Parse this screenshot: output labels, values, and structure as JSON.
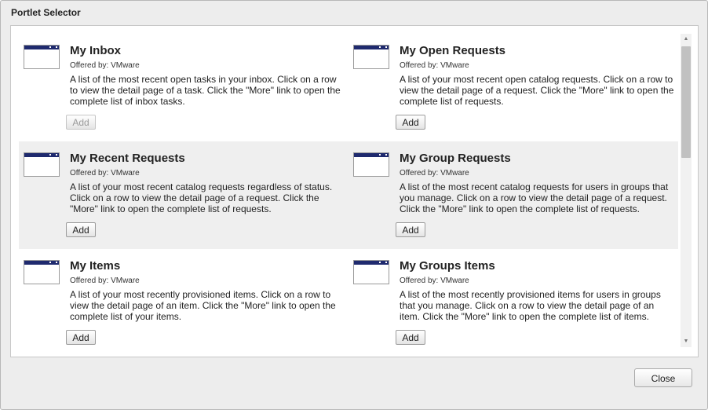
{
  "dialog": {
    "title": "Portlet Selector",
    "close_label": "Close"
  },
  "portlets": [
    {
      "name": "My Inbox",
      "offered_by": "Offered by: VMware",
      "description": "A list of the most recent open tasks in your inbox. Click on a row to view the detail page of a task. Click the \"More\" link to open the complete list of inbox tasks.",
      "add_label": "Add",
      "add_enabled": false
    },
    {
      "name": "My Open Requests",
      "offered_by": "Offered by: VMware",
      "description": "A list of your most recent open catalog requests. Click on a row to view the detail page of a request. Click the \"More\" link to open the complete list of requests.",
      "add_label": "Add",
      "add_enabled": true
    },
    {
      "name": "My Recent Requests",
      "offered_by": "Offered by: VMware",
      "description": "A list of your most recent catalog requests regardless of status. Click on a row to view the detail page of a request. Click the \"More\" link to open the complete list of requests.",
      "add_label": "Add",
      "add_enabled": true
    },
    {
      "name": "My Group Requests",
      "offered_by": "Offered by: VMware",
      "description": "A list of the most recent catalog requests for users in groups that you manage. Click on a row to view the detail page of a request. Click the \"More\" link to open the complete list of requests.",
      "add_label": "Add",
      "add_enabled": true
    },
    {
      "name": "My Items",
      "offered_by": "Offered by: VMware",
      "description": "A list of your most recently provisioned items. Click on a row to view the detail page of an item. Click the \"More\" link to open the complete list of your items.",
      "add_label": "Add",
      "add_enabled": true
    },
    {
      "name": "My Groups Items",
      "offered_by": "Offered by: VMware",
      "description": "A list of the most recently provisioned items for users in groups that you manage. Click on a row to view the detail page of an item. Click the \"More\" link to open the complete list of items.",
      "add_label": "Add",
      "add_enabled": true
    }
  ],
  "icons": {
    "scroll_up": "scroll-up-arrow-icon",
    "scroll_down": "scroll-down-arrow-icon",
    "thumbnail": "portlet-thumbnail-icon"
  },
  "colors": {
    "thumbnail_header": "#1f2a6e",
    "alt_row": "#efefef"
  }
}
